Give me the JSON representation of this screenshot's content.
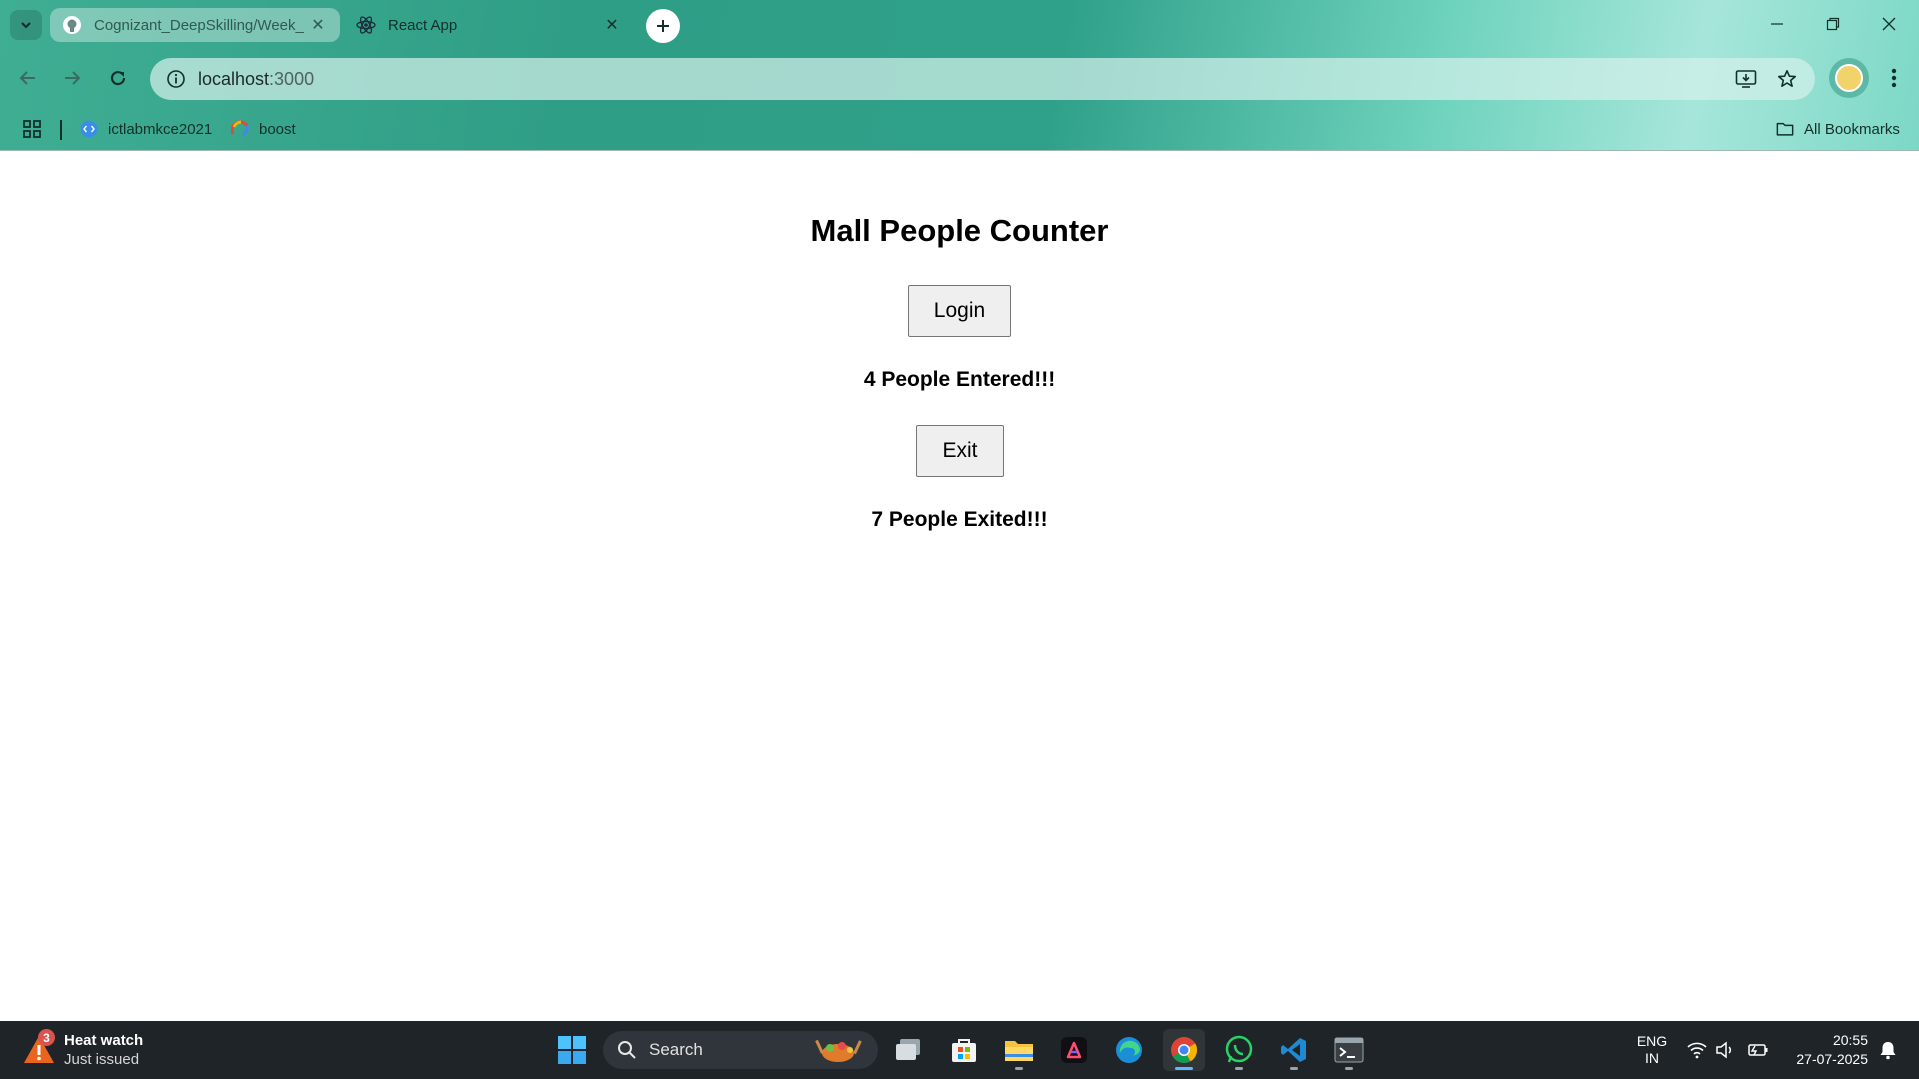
{
  "browser": {
    "tabs": [
      {
        "title": "Cognizant_DeepSkilling/Week_",
        "active": false
      },
      {
        "title": "React App",
        "active": true
      }
    ],
    "url_host": "localhost",
    "url_port": ":3000",
    "bookmarks": [
      {
        "label": "ictlabmkce2021",
        "icon": "code-icon"
      },
      {
        "label": "boost",
        "icon": "boost-icon"
      }
    ],
    "all_bookmarks_label": "All Bookmarks"
  },
  "app": {
    "title": "Mall People Counter",
    "login_button": "Login",
    "entered_text": "4 People Entered!!!",
    "exit_button": "Exit",
    "exited_text": "7 People Exited!!!",
    "entered_count": 4,
    "exited_count": 7
  },
  "taskbar": {
    "weather_badge": "3",
    "weather_title": "Heat watch",
    "weather_subtitle": "Just issued",
    "search_placeholder": "Search",
    "lang_line1": "ENG",
    "lang_line2": "IN",
    "time": "20:55",
    "date": "27-07-2025",
    "accent_color": "#5fb8ff"
  }
}
